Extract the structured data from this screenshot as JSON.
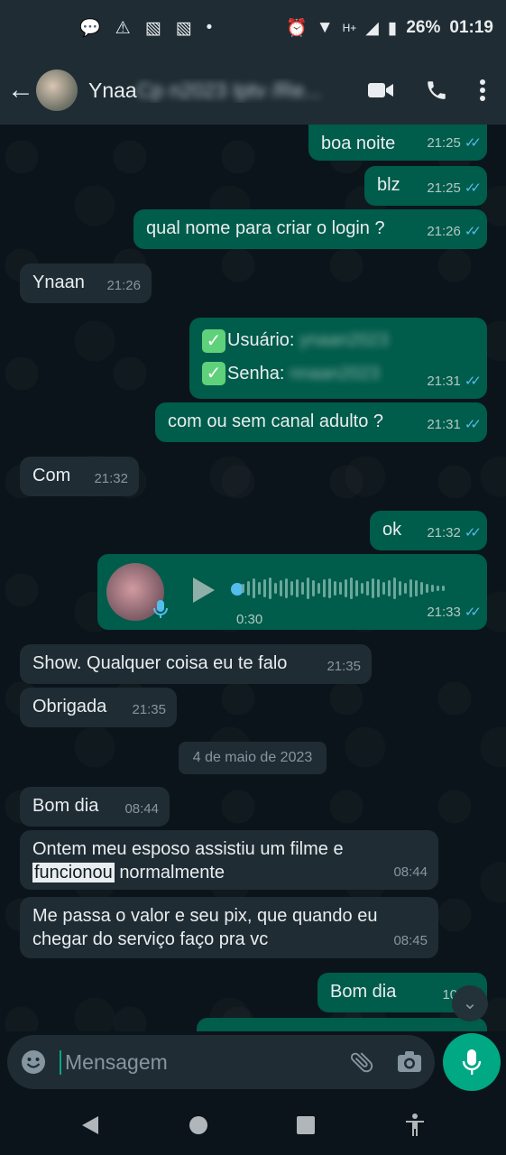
{
  "statusbar": {
    "battery": "26%",
    "time": "01:19",
    "network": "H+"
  },
  "header": {
    "contact_visible": "Ynaa",
    "contact_blurred": "Cp n2023 Iptv /Re..."
  },
  "messages": [
    {
      "text": "boa noite",
      "time": "21:25"
    },
    {
      "text": "blz",
      "time": "21:25"
    },
    {
      "text": "qual nome para criar o login ?",
      "time": "21:26"
    },
    {
      "text": "Ynaan",
      "time": "21:26"
    },
    {
      "user_label": "Usuário:",
      "pass_label": "Senha:",
      "time": "21:31"
    },
    {
      "text": "com ou sem canal adulto ?",
      "time": "21:31"
    },
    {
      "text": "Com",
      "time": "21:32"
    },
    {
      "text": "ok",
      "time": "21:32"
    },
    {
      "duration": "0:30",
      "time": "21:33"
    },
    {
      "text": "Show. Qualquer coisa eu te falo",
      "time": "21:35"
    },
    {
      "text": "Obrigada",
      "time": "21:35"
    },
    {
      "text": "Bom dia",
      "time": "08:44"
    },
    {
      "text_a": "Ontem meu esposo assistiu um filme e",
      "text_hl": "funcionou",
      "text_b": "normalmente",
      "time": "08:44"
    },
    {
      "text_a": "Me passa o valor e seu pix, que quando eu",
      "text_b": "chegar do serviço faço pra vc",
      "time": "08:45"
    },
    {
      "text": "Bom dia",
      "time": "10:40"
    }
  ],
  "date_divider": "4 de maio de 2023",
  "composer": {
    "placeholder": "Mensagem"
  },
  "colors": {
    "outgoing": "#005c4b",
    "incoming": "#1f2c34",
    "accent": "#00a884",
    "ticks": "#53bdeb"
  }
}
